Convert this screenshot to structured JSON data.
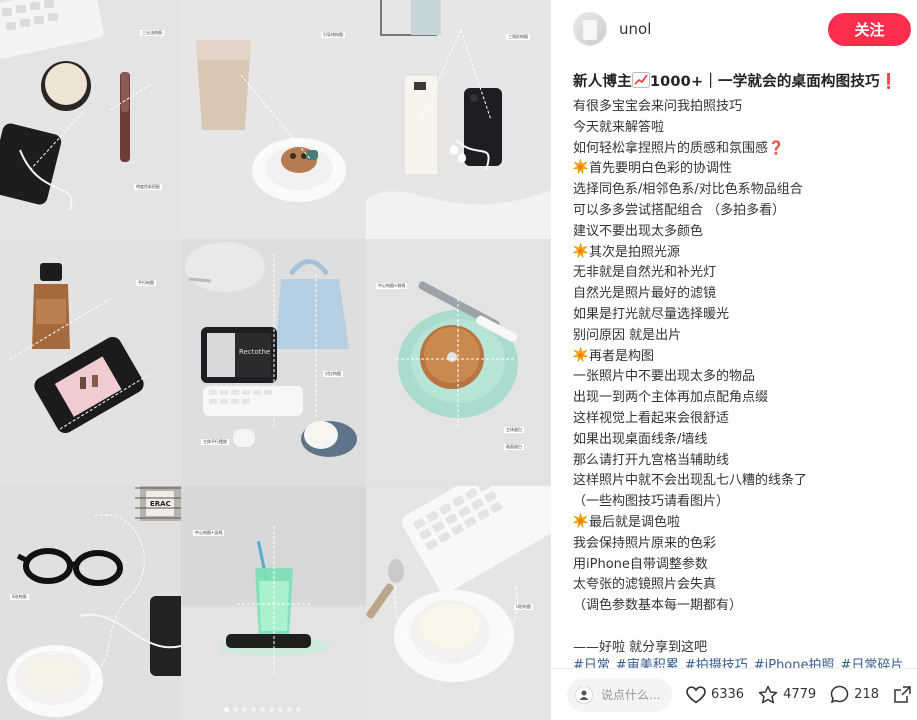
{
  "grid": {
    "tags": {
      "c1a": "三分法构图",
      "c1b": "明度色彩搭配",
      "c1c": "对角线构图",
      "c2a": "引导线构图",
      "c3a": "三角形构图",
      "c4a": "平行构图",
      "c5a": "中心构图+留白",
      "c5b": "对比构图",
      "c5c": "主体平行摆放",
      "c6a": "中心构图+斜线",
      "c6b": "主体留白",
      "c6c": "画面留白",
      "c7a": "S形构图",
      "c8a": "中心构图+竖线",
      "c9a": "U形构图"
    },
    "product_label": "ERAC",
    "tablet_label": "Rectothe",
    "slide_count": 9,
    "active_slide": 1
  },
  "author": {
    "name": "unol"
  },
  "follow_label": "关注",
  "title": {
    "before": "新人博主",
    "after": "1000+｜一学就会的桌面构图技巧",
    "bang": "❗"
  },
  "body_lines": [
    {
      "spark": false,
      "text": "有很多宝宝会来问我拍照技巧"
    },
    {
      "spark": false,
      "text": "今天就来解答啦"
    },
    {
      "spark": false,
      "text": "如何轻松拿捏照片的质感和氛围感",
      "q": "❓"
    },
    {
      "spark": true,
      "text": "首先要明白色彩的协调性"
    },
    {
      "spark": false,
      "text": "选择同色系/相邻色系/对比色系物品组合"
    },
    {
      "spark": false,
      "text": "可以多多尝试搭配组合 （多拍多看）"
    },
    {
      "spark": false,
      "text": "建议不要出现太多颜色"
    },
    {
      "spark": true,
      "text": "其次是拍照光源"
    },
    {
      "spark": false,
      "text": "无非就是自然光和补光灯"
    },
    {
      "spark": false,
      "text": "自然光是照片最好的滤镜"
    },
    {
      "spark": false,
      "text": "如果是打光就尽量选择暖光"
    },
    {
      "spark": false,
      "text": "别问原因 就是出片"
    },
    {
      "spark": true,
      "text": "再者是构图"
    },
    {
      "spark": false,
      "text": "一张照片中不要出现太多的物品"
    },
    {
      "spark": false,
      "text": "出现一到两个主体再加点配角点缀"
    },
    {
      "spark": false,
      "text": "这样视觉上看起来会很舒适"
    },
    {
      "spark": false,
      "text": "如果出现桌面线条/墙线"
    },
    {
      "spark": false,
      "text": "那么请打开九宫格当辅助线"
    },
    {
      "spark": false,
      "text": "这样照片中就不会出现乱七八糟的线条了"
    },
    {
      "spark": false,
      "text": "（一些构图技巧请看图片）"
    },
    {
      "spark": true,
      "text": "最后就是调色啦"
    },
    {
      "spark": false,
      "text": "我会保持照片原来的色彩"
    },
    {
      "spark": false,
      "text": "用iPhone自带调整参数"
    },
    {
      "spark": false,
      "text": "太夸张的滤镜照片会失真"
    },
    {
      "spark": false,
      "text": "（调色参数基本每一期都有）"
    },
    {
      "spark": false,
      "text": ""
    },
    {
      "spark": false,
      "text": "——好啦 就分享到这吧"
    }
  ],
  "hashtags": [
    "#日常",
    "#审美积累",
    "#拍摄技巧",
    "#iPhone拍照",
    "#日常碎片"
  ],
  "bottom": {
    "comment_placeholder": "说点什么...",
    "likes": "6336",
    "collects": "4779",
    "comments": "218"
  },
  "colors": {
    "accent": "#ff2e4d",
    "hashtag": "#13386c"
  },
  "icons": [
    "heart-icon",
    "star-icon",
    "comment-bubble-icon",
    "share-icon",
    "sparkle-icon",
    "chart-up-icon"
  ]
}
